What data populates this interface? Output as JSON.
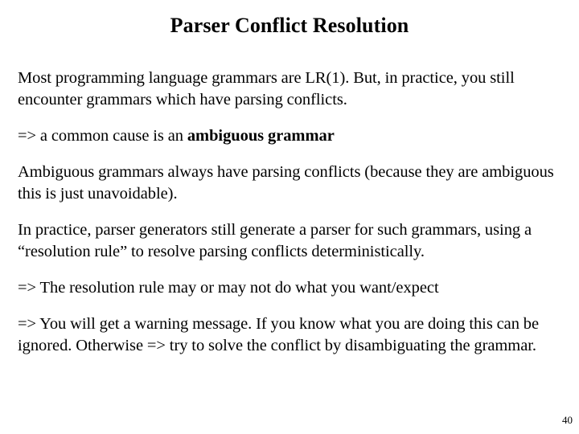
{
  "slide": {
    "title": "Parser Conflict Resolution",
    "page_number": "40",
    "paragraphs": {
      "p1": "Most programming language grammars are LR(1). But, in practice, you still encounter grammars which have parsing conflicts.",
      "p2_lead": "=> a common cause is an ",
      "p2_bold": "ambiguous grammar",
      "p3": "Ambiguous grammars always have parsing conflicts (because they are ambiguous this is just unavoidable).",
      "p4": "In practice, parser generators still generate a parser for such grammars, using a “resolution rule” to resolve parsing conflicts deterministically.",
      "p5": "=> The resolution rule may or may not do what you want/expect",
      "p6": "=> You will get a warning message. If you know what you are doing this can be ignored. Otherwise => try to solve the conflict by disambiguating the grammar."
    }
  },
  "colors": {
    "background": "#ffffff",
    "text": "#000000"
  }
}
